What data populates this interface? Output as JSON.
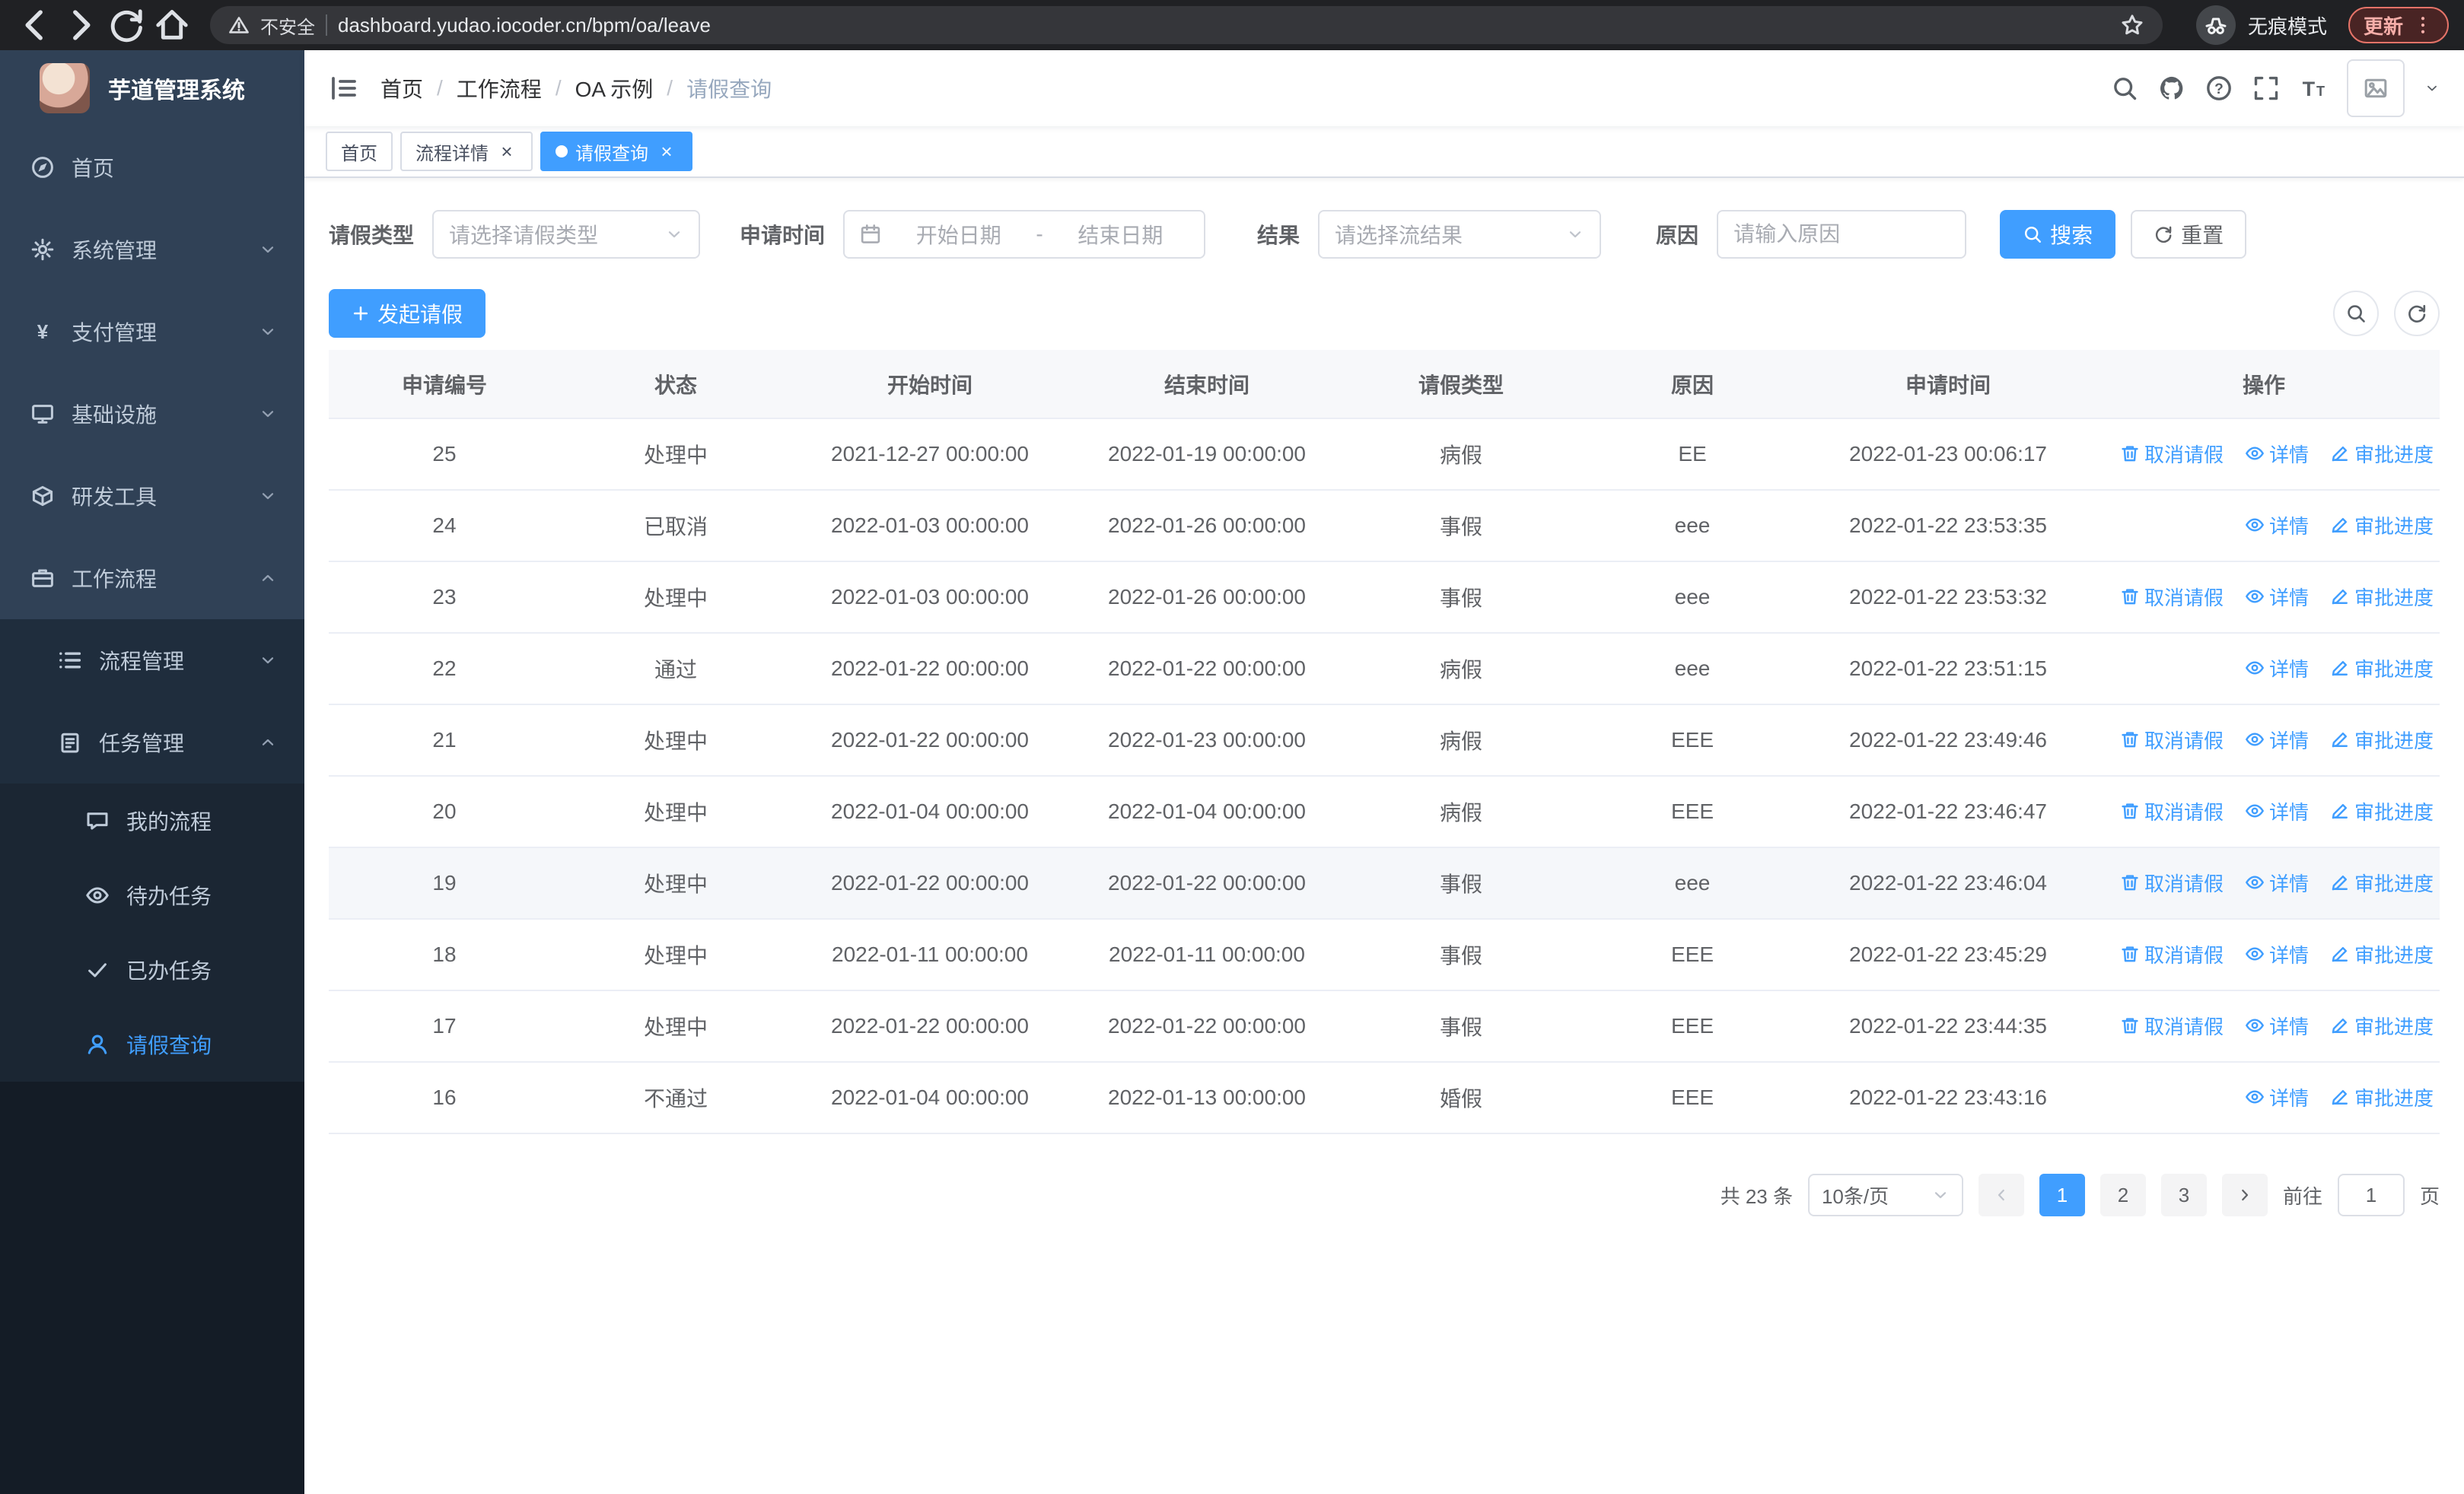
{
  "browser": {
    "security_text": "不安全",
    "url": "dashboard.yudao.iocoder.cn/bpm/oa/leave",
    "incognito_label": "无痕模式",
    "update_label": "更新"
  },
  "sidebar": {
    "logo_title": "芋道管理系统",
    "menu": [
      {
        "id": "home",
        "label": "首页",
        "icon": "dashboard",
        "level": 1
      },
      {
        "id": "system-mgmt",
        "label": "系统管理",
        "icon": "gear",
        "level": 1,
        "arrow": "down"
      },
      {
        "id": "payment-mgmt",
        "label": "支付管理",
        "icon": "yen",
        "level": 1,
        "arrow": "down"
      },
      {
        "id": "infrastructure",
        "label": "基础设施",
        "icon": "monitor",
        "level": 1,
        "arrow": "down"
      },
      {
        "id": "dev-tools",
        "label": "研发工具",
        "icon": "cube",
        "level": 1,
        "arrow": "down"
      },
      {
        "id": "workflow",
        "label": "工作流程",
        "icon": "briefcase",
        "level": 1,
        "arrow": "up"
      },
      {
        "id": "process-mgmt",
        "label": "流程管理",
        "icon": "list",
        "level": 2,
        "arrow": "down"
      },
      {
        "id": "task-mgmt",
        "label": "任务管理",
        "icon": "clipboard",
        "level": 2,
        "arrow": "up"
      },
      {
        "id": "my-process",
        "label": "我的流程",
        "icon": "chat",
        "level": 3
      },
      {
        "id": "todo-task",
        "label": "待办任务",
        "icon": "eye",
        "level": 3
      },
      {
        "id": "done-task",
        "label": "已办任务",
        "icon": "check",
        "level": 3
      },
      {
        "id": "leave-query",
        "label": "请假查询",
        "icon": "user",
        "level": 3,
        "active": true
      }
    ]
  },
  "navbar": {
    "breadcrumb": [
      "首页",
      "工作流程",
      "OA 示例",
      "请假查询"
    ]
  },
  "tabs": [
    {
      "id": "home",
      "label": "首页",
      "closable": false,
      "active": false
    },
    {
      "id": "process-detail",
      "label": "流程详情",
      "closable": true,
      "active": false
    },
    {
      "id": "leave-query",
      "label": "请假查询",
      "closable": true,
      "active": true
    }
  ],
  "filters": {
    "leave_type_label": "请假类型",
    "leave_type_placeholder": "请选择请假类型",
    "apply_time_label": "申请时间",
    "start_placeholder": "开始日期",
    "range_separator": "-",
    "end_placeholder": "结束日期",
    "result_label": "结果",
    "result_placeholder": "请选择流结果",
    "reason_label": "原因",
    "reason_placeholder": "请输入原因",
    "search_label": "搜索",
    "reset_label": "重置"
  },
  "toolbar": {
    "create_label": "发起请假"
  },
  "table": {
    "columns": [
      "申请编号",
      "状态",
      "开始时间",
      "结束时间",
      "请假类型",
      "原因",
      "申请时间",
      "操作"
    ],
    "action_labels": {
      "cancel": "取消请假",
      "detail": "详情",
      "progress": "审批进度"
    },
    "rows": [
      {
        "id": "25",
        "status": "处理中",
        "start": "2021-12-27 00:00:00",
        "end": "2022-01-19 00:00:00",
        "type": "病假",
        "reason": "EE",
        "apply_time": "2022-01-23 00:06:17",
        "actions": [
          "cancel",
          "detail",
          "progress"
        ]
      },
      {
        "id": "24",
        "status": "已取消",
        "start": "2022-01-03 00:00:00",
        "end": "2022-01-26 00:00:00",
        "type": "事假",
        "reason": "eee",
        "apply_time": "2022-01-22 23:53:35",
        "actions": [
          "detail",
          "progress"
        ]
      },
      {
        "id": "23",
        "status": "处理中",
        "start": "2022-01-03 00:00:00",
        "end": "2022-01-26 00:00:00",
        "type": "事假",
        "reason": "eee",
        "apply_time": "2022-01-22 23:53:32",
        "actions": [
          "cancel",
          "detail",
          "progress"
        ]
      },
      {
        "id": "22",
        "status": "通过",
        "start": "2022-01-22 00:00:00",
        "end": "2022-01-22 00:00:00",
        "type": "病假",
        "reason": "eee",
        "apply_time": "2022-01-22 23:51:15",
        "actions": [
          "detail",
          "progress"
        ]
      },
      {
        "id": "21",
        "status": "处理中",
        "start": "2022-01-22 00:00:00",
        "end": "2022-01-23 00:00:00",
        "type": "病假",
        "reason": "EEE",
        "apply_time": "2022-01-22 23:49:46",
        "actions": [
          "cancel",
          "detail",
          "progress"
        ]
      },
      {
        "id": "20",
        "status": "处理中",
        "start": "2022-01-04 00:00:00",
        "end": "2022-01-04 00:00:00",
        "type": "病假",
        "reason": "EEE",
        "apply_time": "2022-01-22 23:46:47",
        "actions": [
          "cancel",
          "detail",
          "progress"
        ]
      },
      {
        "id": "19",
        "status": "处理中",
        "start": "2022-01-22 00:00:00",
        "end": "2022-01-22 00:00:00",
        "type": "事假",
        "reason": "eee",
        "apply_time": "2022-01-22 23:46:04",
        "actions": [
          "cancel",
          "detail",
          "progress"
        ],
        "highlighted": true
      },
      {
        "id": "18",
        "status": "处理中",
        "start": "2022-01-11 00:00:00",
        "end": "2022-01-11 00:00:00",
        "type": "事假",
        "reason": "EEE",
        "apply_time": "2022-01-22 23:45:29",
        "actions": [
          "cancel",
          "detail",
          "progress"
        ]
      },
      {
        "id": "17",
        "status": "处理中",
        "start": "2022-01-22 00:00:00",
        "end": "2022-01-22 00:00:00",
        "type": "事假",
        "reason": "EEE",
        "apply_time": "2022-01-22 23:44:35",
        "actions": [
          "cancel",
          "detail",
          "progress"
        ]
      },
      {
        "id": "16",
        "status": "不通过",
        "start": "2022-01-04 00:00:00",
        "end": "2022-01-13 00:00:00",
        "type": "婚假",
        "reason": "EEE",
        "apply_time": "2022-01-22 23:43:16",
        "actions": [
          "detail",
          "progress"
        ]
      }
    ]
  },
  "pagination": {
    "total_text": "共 23 条",
    "page_size": "10条/页",
    "pages": [
      "1",
      "2",
      "3"
    ],
    "current": "1",
    "goto_label": "前往",
    "goto_value": "1",
    "goto_unit": "页"
  },
  "colors": {
    "primary": "#409EFF"
  }
}
